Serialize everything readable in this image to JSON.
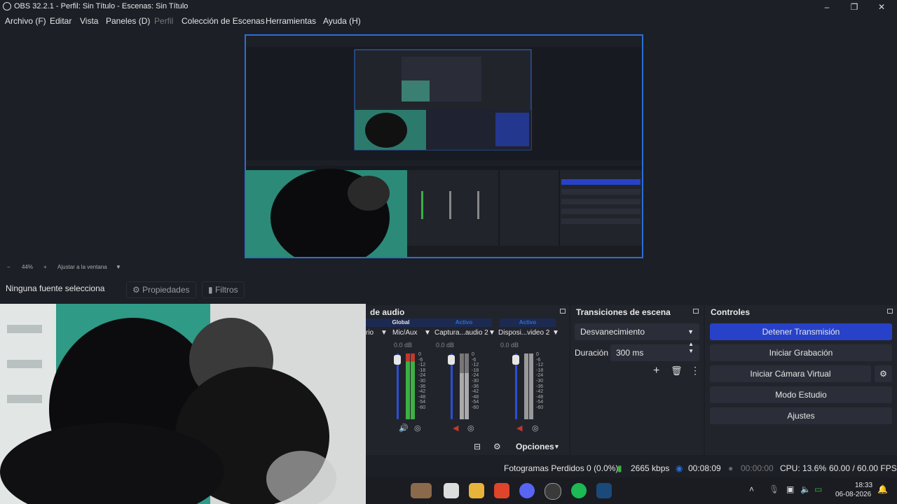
{
  "window": {
    "title": "OBS 32.2.1 - Perfil: Sin Título - Escenas: Sin Título",
    "controls": [
      "–",
      "❐",
      "✕"
    ]
  },
  "menu": [
    {
      "label": "Archivo (F)",
      "enabled": true
    },
    {
      "label": "Editar",
      "enabled": true
    },
    {
      "label": "Vista",
      "enabled": true
    },
    {
      "label": "Paneles (D)",
      "enabled": true
    },
    {
      "label": "Perfil",
      "enabled": false
    },
    {
      "label": "Colección de Escenas",
      "enabled": true
    },
    {
      "label": "Herramientas",
      "enabled": true
    },
    {
      "label": "Ayuda (H)",
      "enabled": true
    }
  ],
  "zoom": {
    "minus": "−",
    "value": "44%",
    "plus": "+",
    "fit": "Ajustar a la ventana"
  },
  "source_toolbar": {
    "no_source": "Ninguna fuente selecciona",
    "properties": "Propiedades",
    "filters": "Filtros"
  },
  "audio": {
    "title": "de audio",
    "channels": [
      {
        "header": "Global",
        "name": "Mic/Aux",
        "db": "0.0 dB",
        "prefix": "rio"
      },
      {
        "header": "Activo",
        "name": "Captura...audio 2",
        "db": "0.0 dB"
      },
      {
        "header": "Activo",
        "name": "Disposi...video 2",
        "db": "0.0 dB"
      }
    ],
    "scale": [
      "0",
      "-6",
      "-12",
      "-18",
      "-24",
      "-30",
      "-36",
      "-42",
      "-48",
      "-54",
      "-60"
    ],
    "options": "Opciones"
  },
  "transitions": {
    "title": "Transiciones de escena",
    "selected": "Desvanecimiento",
    "duration_label": "Duración",
    "duration_value": "300 ms"
  },
  "controls": {
    "title": "Controles",
    "buttons": [
      "Detener Transmisión",
      "Iniciar Grabación",
      "Iniciar Cámara Virtual",
      "Modo Estudio",
      "Ajustes"
    ]
  },
  "status": {
    "dropped": "Fotogramas Perdidos 0 (0.0%)",
    "bitrate": "2665 kbps",
    "stream_time": "00:08:09",
    "rec_time": "00:00:00",
    "cpu": "CPU: 13.6%",
    "fps": "60.00 / 60.00 FPS"
  },
  "taskbar": {
    "time": "18:33",
    "date": "06-08-2026"
  },
  "colors": {
    "accent": "#2742c8",
    "selection_border": "#2a6fd6",
    "meter_green": "#3cb043",
    "meter_red": "#c0392b"
  }
}
